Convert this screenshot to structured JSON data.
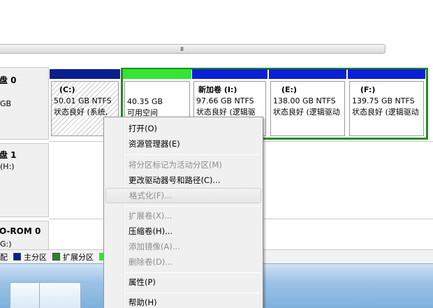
{
  "scrollbar": {
    "grip": "III"
  },
  "disks": [
    {
      "title": "盘 0",
      "line1": "GB"
    },
    {
      "title": "盘 1",
      "line1": "(H:)"
    },
    {
      "title": "O-ROM 0",
      "line1": "G:)"
    }
  ],
  "partitions": [
    {
      "name": "(C:)",
      "size": "50.01 GB NTFS",
      "status": "状态良好 (系统,",
      "bar_color": "#0a1f8f"
    },
    {
      "name": "",
      "size": "40.35 GB",
      "status": "可用空间",
      "bar_color": "#33e633"
    },
    {
      "name": "新加卷 (I:)",
      "size": "97.66 GB NTFS",
      "status": "状态良好 (逻辑驱",
      "bar_color": "#0b20d6"
    },
    {
      "name": "(E:)",
      "size": "138.00 GB NTFS",
      "status": "状态良好 (逻辑驱动",
      "bar_color": "#0b20d6"
    },
    {
      "name": "(F:)",
      "size": "139.75 GB NTFS",
      "status": "状态良好 (逻辑驱动",
      "bar_color": "#0b20d6"
    }
  ],
  "legend": [
    {
      "label": "配",
      "color": ""
    },
    {
      "label": "主分区",
      "color": "#0a1f8f"
    },
    {
      "label": "扩展分区",
      "color": "#218c21"
    }
  ],
  "context_menu": {
    "items": [
      {
        "label": "打开(O)",
        "enabled": true
      },
      {
        "label": "资源管理器(E)",
        "enabled": true
      },
      {
        "label": "将分区标记为活动分区(M)",
        "enabled": false
      },
      {
        "label": "更改驱动器号和路径(C)...",
        "enabled": true
      },
      {
        "label": "格式化(F)...",
        "enabled": false
      },
      {
        "label": "扩展卷(X)...",
        "enabled": false
      },
      {
        "label": "压缩卷(H)...",
        "enabled": true
      },
      {
        "label": "添加镜像(A)...",
        "enabled": false
      },
      {
        "label": "删除卷(D)...",
        "enabled": false
      },
      {
        "label": "属性(P)",
        "enabled": true
      },
      {
        "label": "帮助(H)",
        "enabled": true
      }
    ]
  }
}
